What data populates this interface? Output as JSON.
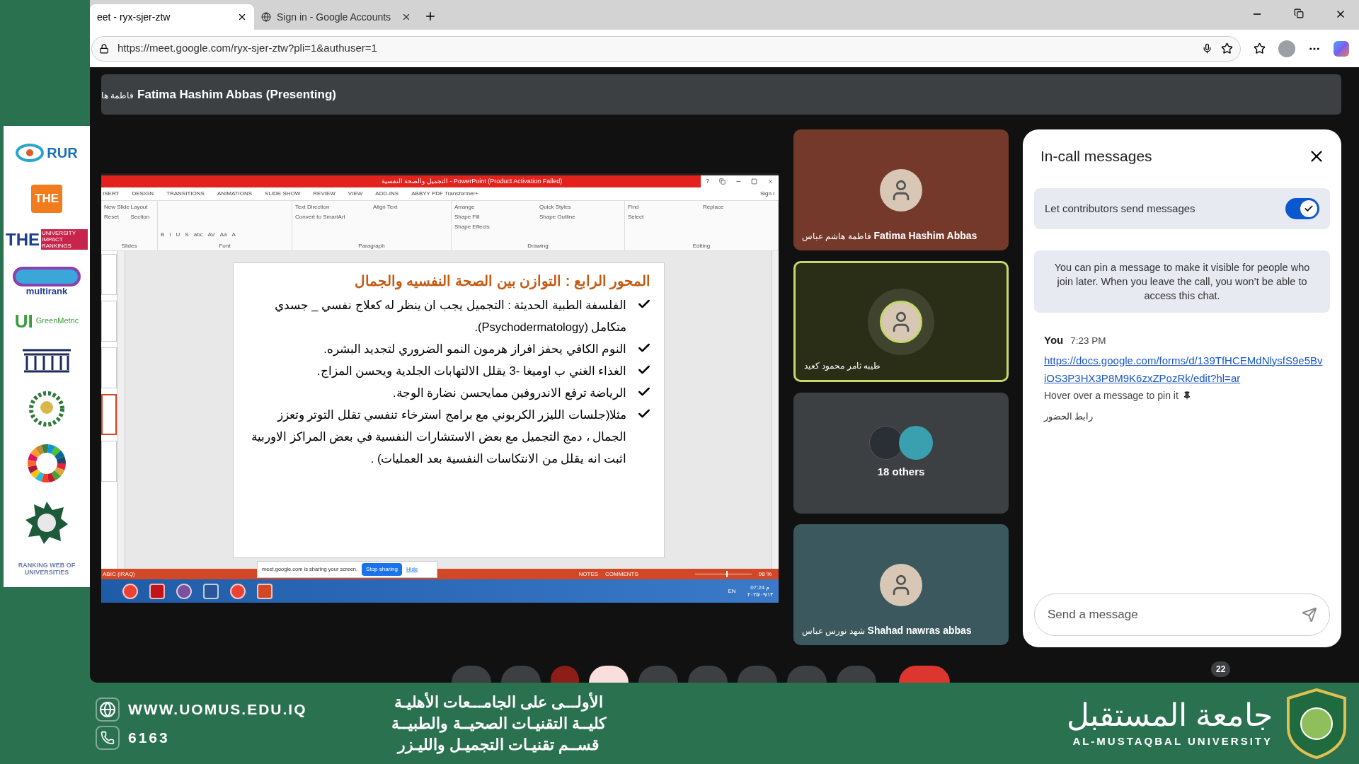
{
  "left_panel": {
    "logos": [
      {
        "kind": "wordmark",
        "text": "RUR"
      },
      {
        "kind": "tile",
        "text": "THE"
      },
      {
        "kind": "impact",
        "text": "THE",
        "subtext": "UNIVERSITY IMPACT RANKINGS"
      },
      {
        "kind": "multirank",
        "text": "multirank"
      },
      {
        "kind": "green",
        "text": "UI",
        "subtext": "GreenMetric"
      },
      {
        "kind": "pillars"
      },
      {
        "kind": "wreath"
      },
      {
        "kind": "wheel"
      },
      {
        "kind": "seal"
      },
      {
        "kind": "web",
        "text": "RANKING WEB OF UNIVERSITIES"
      }
    ]
  },
  "browser": {
    "tabs": [
      {
        "label": "eet - ryx-sjer-ztw",
        "selected": true
      },
      {
        "label": "Sign in - Google Accounts",
        "selected": false
      }
    ],
    "url": "https://meet.google.com/ryx-sjer-ztw?pli=1&authuser=1"
  },
  "presenter_bar": {
    "name_ar": "فاطمة ها",
    "name": "Fatima Hashim Abbas (Presenting)"
  },
  "presentation": {
    "title": "التجميل والصحة النفسية  -  PowerPoint (Product Activation Failed)",
    "help": "?",
    "sign_in": "Sign i",
    "menu": [
      "ISERT",
      "DESIGN",
      "TRANSITIONS",
      "ANIMATIONS",
      "SLIDE SHOW",
      "REVIEW",
      "VIEW",
      "ADD-INS",
      "ABBYY PDF Transformer+"
    ],
    "ribbon_groups": [
      {
        "label": "Slides",
        "items": [
          "New Slide",
          "Layout",
          "Reset",
          "Section"
        ]
      },
      {
        "label": "Font",
        "items": [
          "B",
          "I",
          "U",
          "S",
          "abc",
          "AV",
          "Aa",
          "A"
        ]
      },
      {
        "label": "Paragraph",
        "items": [
          "Text Direction",
          "Align Text",
          "Convert to SmartArt"
        ]
      },
      {
        "label": "Drawing",
        "items": [
          "Arrange",
          "Quick Styles",
          "Shape Fill",
          "Shape Outline",
          "Shape Effects"
        ]
      },
      {
        "label": "Editing",
        "items": [
          "Find",
          "Replace",
          "Select"
        ]
      }
    ],
    "thumbnails": [
      {
        "selected": false
      },
      {
        "selected": false
      },
      {
        "selected": false
      },
      {
        "selected": true
      },
      {
        "selected": false
      }
    ],
    "slide": {
      "title": "المحور الرابع : التوازن بين الصحة النفسيه والجمال",
      "bullets": [
        "الفلسفة الطبية الحديثة : التجميل يجب ان ينظر له كعلاج نفسي _ جسدي متكامل (Psychodermatology).",
        "النوم الكافي يحفز افراز هرمون النمو الضروري لتجديد البشره.",
        "الغذاء الغني ب اوميغا -3 يقلل الالتهابات الجلدية ويحسن المزاج.",
        "الرياضة ترفع الاندروفين ممايحسن نضارة الوجة.",
        "مثلا(جلسات الليزر الكربوني مع برامج استرخاء تنفسي تقلل التوتر وتعزز الجمال ، دمج التجميل مع بعض الاستشارات النفسية في بعض المراكز الاوربية اثبت انه يقلل من الانتكاسات النفسية بعد العمليات) ."
      ]
    },
    "sharing_bar": {
      "text": "meet.google.com is sharing your screen.",
      "stop": "Stop sharing",
      "hide": "Hide"
    },
    "status_bar": {
      "language": "ABIC (IRAQ)",
      "notes": "NOTES",
      "comments": "COMMENTS",
      "zoom": "98 %",
      "level": 0.55
    },
    "taskbar": {
      "apps": [
        {
          "kind": "chrome"
        },
        {
          "kind": "acrobat"
        },
        {
          "kind": "viber"
        },
        {
          "kind": "word"
        },
        {
          "kind": "chrome"
        },
        {
          "kind": "powerpoint"
        }
      ],
      "lang": "EN",
      "time": "07:24 م",
      "date": "٢٠٢٥/٠٩/١٣"
    }
  },
  "tiles": [
    {
      "kind": "person",
      "name_ar": "فاطمة هاشم عباس",
      "name": "Fatima Hashim Abbas",
      "color": "#74392a",
      "speaking": false
    },
    {
      "kind": "person",
      "name_ar": "طيبه ثامر محمود كعيد",
      "color": "#2b2e17",
      "speaking": true
    },
    {
      "kind": "others",
      "label": "18 others",
      "color": "#3c4043",
      "speaking": false
    },
    {
      "kind": "person",
      "name_ar": "شهد نورس عباس",
      "name": "Shahad nawras abbas",
      "color": "#3b585e",
      "speaking": false
    }
  ],
  "chat": {
    "title": "In-call messages",
    "setting": {
      "label": "Let contributors send messages",
      "on": true
    },
    "info": "You can pin a message to make it visible for people who join later. When you leave the call, you won’t be able to access this chat.",
    "messages": [
      {
        "author": "You",
        "time": "7:23 PM",
        "link": "https://docs.google.com/forms/d/139TfHCEMdNlysfS9e5BviOS3P3HX3P8M9K6zxZPozRk/edit?hl=ar",
        "hint": "Hover over a message to pin it",
        "text": "رابط الحضور"
      }
    ],
    "input": {
      "placeholder": "Send a message"
    }
  },
  "controls": [
    {
      "kind": "dark"
    },
    {
      "kind": "dark"
    },
    {
      "kind": "alert"
    },
    {
      "kind": "active"
    },
    {
      "kind": "dark"
    },
    {
      "kind": "dark"
    },
    {
      "kind": "dark"
    },
    {
      "kind": "dark"
    },
    {
      "kind": "dark"
    },
    {
      "kind": "hangup"
    }
  ],
  "participants_badge": "22",
  "banner": {
    "website": "WWW.UOMUS.EDU.IQ",
    "phone": "6163",
    "lines": [
      "الأولـــى على الجامـــعات الأهليـة",
      "كليــة التقنيـات الصحيــة والطبيــة",
      "قســم تقنيـات التجميـل والليـزر"
    ],
    "university_ar": "جامعة المستقبل",
    "university_en": "AL-MUSTAQBAL UNIVERSITY"
  }
}
